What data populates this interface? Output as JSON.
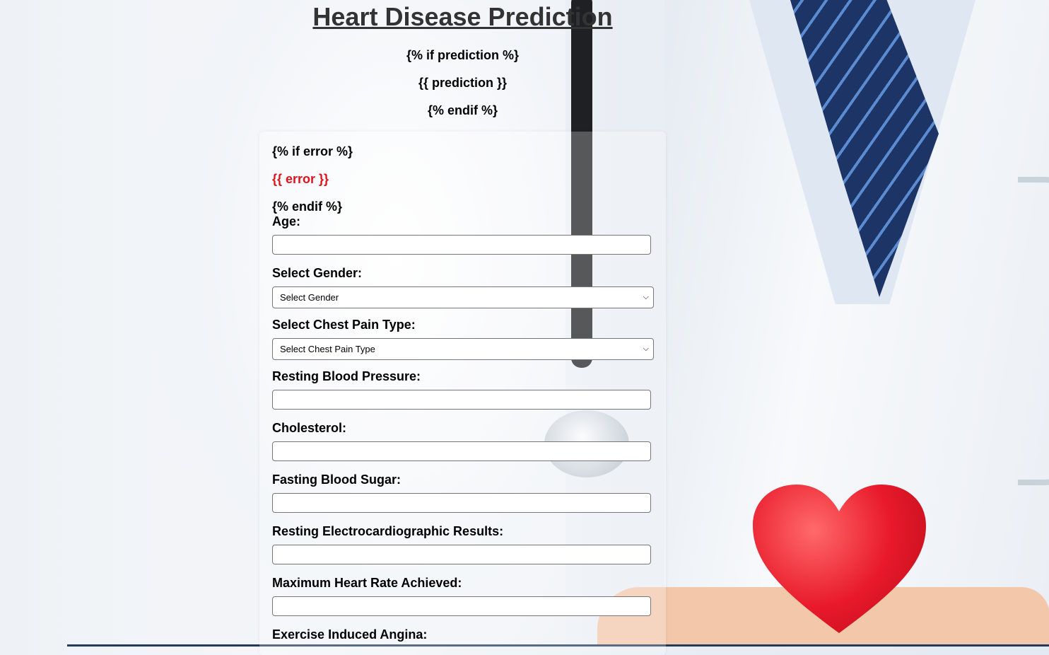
{
  "header": {
    "title": "Heart Disease Prediction",
    "if_prediction": "{% if prediction %}",
    "prediction": "{{ prediction }}",
    "endif": "{% endif %}"
  },
  "form": {
    "if_error": "{% if error %}",
    "error": "{{ error }}",
    "endif": "{% endif %}",
    "error_color": "#e0121b",
    "fields": {
      "age_label": "Age:",
      "gender_label": "Select Gender:",
      "gender_selected": "Select Gender",
      "chest_pain_label": "Select Chest Pain Type:",
      "chest_pain_selected": "Select Chest Pain Type",
      "bp_label": "Resting Blood Pressure:",
      "cholesterol_label": "Cholesterol:",
      "fbs_label": "Fasting Blood Sugar:",
      "ecg_label": "Resting Electrocardiographic Results:",
      "max_hr_label": "Maximum Heart Rate Achieved:",
      "angina_label": "Exercise Induced Angina:"
    }
  }
}
